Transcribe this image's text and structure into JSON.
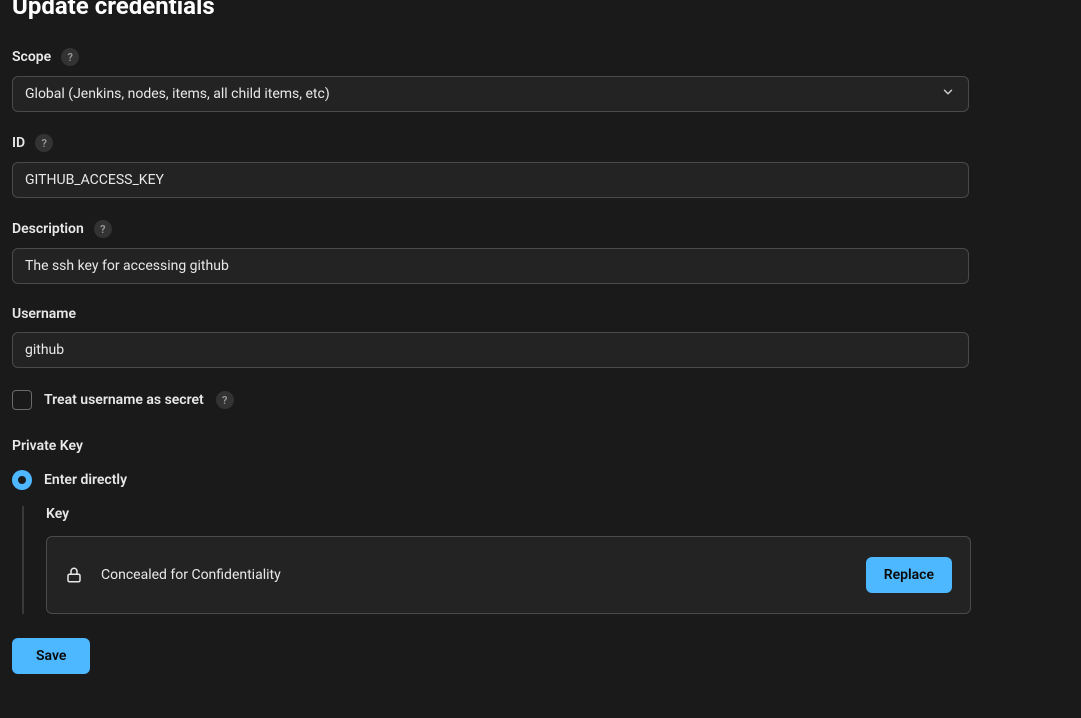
{
  "page": {
    "title": "Update credentials"
  },
  "form": {
    "scope": {
      "label": "Scope",
      "value": "Global (Jenkins, nodes, items, all child items, etc)"
    },
    "id": {
      "label": "ID",
      "value": "GITHUB_ACCESS_KEY"
    },
    "description": {
      "label": "Description",
      "value": "The ssh key for accessing github"
    },
    "username": {
      "label": "Username",
      "value": "github"
    },
    "treatSecret": {
      "label": "Treat username as secret",
      "checked": false
    },
    "privateKey": {
      "label": "Private Key",
      "enterDirectly": {
        "label": "Enter directly",
        "selected": true
      },
      "key": {
        "label": "Key",
        "concealedText": "Concealed for Confidentiality",
        "replaceLabel": "Replace"
      }
    },
    "saveLabel": "Save"
  },
  "helpTooltip": "?"
}
